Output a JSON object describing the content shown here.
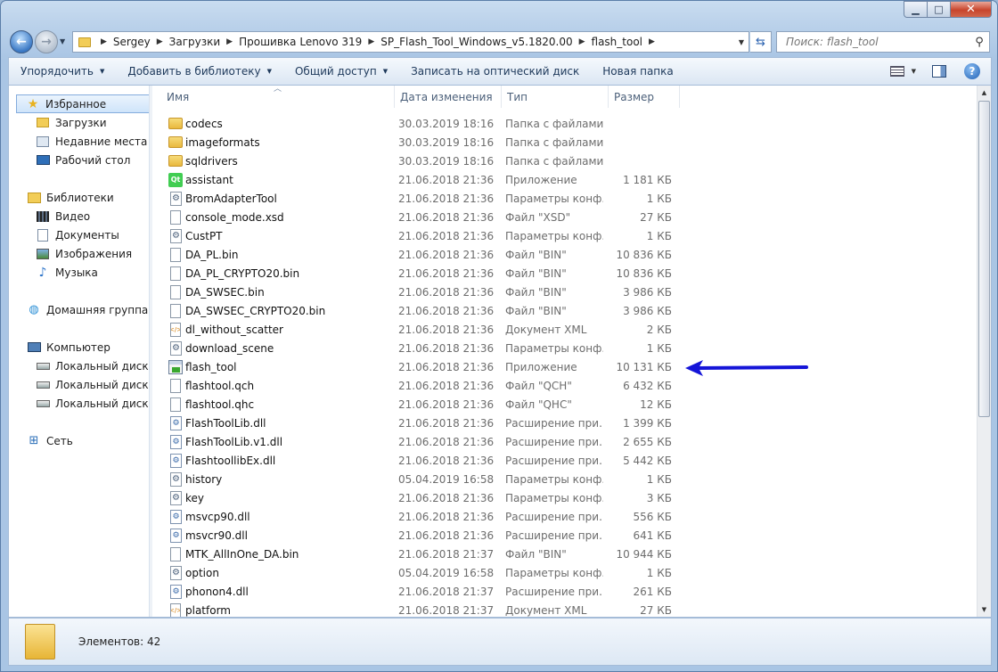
{
  "window": {
    "caption_buttons": [
      "minimize",
      "maximize",
      "close"
    ]
  },
  "address": {
    "crumbs": [
      "Sergey",
      "Загрузки",
      "Прошивка Lenovo 319",
      "SP_Flash_Tool_Windows_v5.1820.00",
      "flash_tool"
    ]
  },
  "search": {
    "placeholder": "Поиск: flash_tool"
  },
  "toolbar": {
    "organize": "Упорядочить",
    "add_library": "Добавить в библиотеку",
    "share": "Общий доступ",
    "burn": "Записать на оптический диск",
    "new_folder": "Новая папка"
  },
  "navpane": {
    "favorites": "Избранное",
    "downloads": "Загрузки",
    "recent": "Недавние места",
    "desktop": "Рабочий стол",
    "libraries": "Библиотеки",
    "video": "Видео",
    "documents": "Документы",
    "images": "Изображения",
    "music": "Музыка",
    "homegroup": "Домашняя группа",
    "computer": "Компьютер",
    "disk_c": "Локальный диск (C",
    "disk_d": "Локальный диск  (D",
    "disk_e": "Локальный диск (E:",
    "network": "Сеть"
  },
  "columns": {
    "name": "Имя",
    "date": "Дата изменения",
    "type": "Тип",
    "size": "Размер"
  },
  "files": [
    {
      "icon": "folder",
      "name": "codecs",
      "date": "30.03.2019 18:16",
      "type": "Папка с файлами",
      "size": ""
    },
    {
      "icon": "folder",
      "name": "imageformats",
      "date": "30.03.2019 18:16",
      "type": "Папка с файлами",
      "size": ""
    },
    {
      "icon": "folder",
      "name": "sqldrivers",
      "date": "30.03.2019 18:16",
      "type": "Папка с файлами",
      "size": ""
    },
    {
      "icon": "qt",
      "name": "assistant",
      "date": "21.06.2018 21:36",
      "type": "Приложение",
      "size": "1 181 КБ"
    },
    {
      "icon": "gear",
      "name": "BromAdapterTool",
      "date": "21.06.2018 21:36",
      "type": "Параметры конф...",
      "size": "1 КБ"
    },
    {
      "icon": "file",
      "name": "console_mode.xsd",
      "date": "21.06.2018 21:36",
      "type": "Файл \"XSD\"",
      "size": "27 КБ"
    },
    {
      "icon": "gear",
      "name": "CustPT",
      "date": "21.06.2018 21:36",
      "type": "Параметры конф...",
      "size": "1 КБ"
    },
    {
      "icon": "file",
      "name": "DA_PL.bin",
      "date": "21.06.2018 21:36",
      "type": "Файл \"BIN\"",
      "size": "10 836 КБ"
    },
    {
      "icon": "file",
      "name": "DA_PL_CRYPTO20.bin",
      "date": "21.06.2018 21:36",
      "type": "Файл \"BIN\"",
      "size": "10 836 КБ"
    },
    {
      "icon": "file",
      "name": "DA_SWSEC.bin",
      "date": "21.06.2018 21:36",
      "type": "Файл \"BIN\"",
      "size": "3 986 КБ"
    },
    {
      "icon": "file",
      "name": "DA_SWSEC_CRYPTO20.bin",
      "date": "21.06.2018 21:36",
      "type": "Файл \"BIN\"",
      "size": "3 986 КБ"
    },
    {
      "icon": "xml",
      "name": "dl_without_scatter",
      "date": "21.06.2018 21:36",
      "type": "Документ XML",
      "size": "2 КБ"
    },
    {
      "icon": "gear",
      "name": "download_scene",
      "date": "21.06.2018 21:36",
      "type": "Параметры конф...",
      "size": "1 КБ"
    },
    {
      "icon": "appg",
      "name": "flash_tool",
      "date": "21.06.2018 21:36",
      "type": "Приложение",
      "size": "10 131 КБ"
    },
    {
      "icon": "file",
      "name": "flashtool.qch",
      "date": "21.06.2018 21:36",
      "type": "Файл \"QCH\"",
      "size": "6 432 КБ"
    },
    {
      "icon": "file",
      "name": "flashtool.qhc",
      "date": "21.06.2018 21:36",
      "type": "Файл \"QHC\"",
      "size": "12 КБ"
    },
    {
      "icon": "dll",
      "name": "FlashToolLib.dll",
      "date": "21.06.2018 21:36",
      "type": "Расширение при...",
      "size": "1 399 КБ"
    },
    {
      "icon": "dll",
      "name": "FlashToolLib.v1.dll",
      "date": "21.06.2018 21:36",
      "type": "Расширение при...",
      "size": "2 655 КБ"
    },
    {
      "icon": "dll",
      "name": "FlashtoollibEx.dll",
      "date": "21.06.2018 21:36",
      "type": "Расширение при...",
      "size": "5 442 КБ"
    },
    {
      "icon": "gear",
      "name": "history",
      "date": "05.04.2019 16:58",
      "type": "Параметры конф...",
      "size": "1 КБ"
    },
    {
      "icon": "gear",
      "name": "key",
      "date": "21.06.2018 21:36",
      "type": "Параметры конф...",
      "size": "3 КБ"
    },
    {
      "icon": "dll",
      "name": "msvcp90.dll",
      "date": "21.06.2018 21:36",
      "type": "Расширение при...",
      "size": "556 КБ"
    },
    {
      "icon": "dll",
      "name": "msvcr90.dll",
      "date": "21.06.2018 21:36",
      "type": "Расширение при...",
      "size": "641 КБ"
    },
    {
      "icon": "file",
      "name": "MTK_AllInOne_DA.bin",
      "date": "21.06.2018 21:37",
      "type": "Файл \"BIN\"",
      "size": "10 944 КБ"
    },
    {
      "icon": "gear",
      "name": "option",
      "date": "05.04.2019 16:58",
      "type": "Параметры конф...",
      "size": "1 КБ"
    },
    {
      "icon": "dll",
      "name": "phonon4.dll",
      "date": "21.06.2018 21:37",
      "type": "Расширение при...",
      "size": "261 КБ"
    },
    {
      "icon": "xml",
      "name": "platform",
      "date": "21.06.2018 21:37",
      "type": "Документ XML",
      "size": "27 КБ"
    }
  ],
  "status": {
    "count": "Элементов: 42"
  },
  "annotation": {
    "arrow_color": "#1515d8",
    "points_to": "flash_tool"
  }
}
